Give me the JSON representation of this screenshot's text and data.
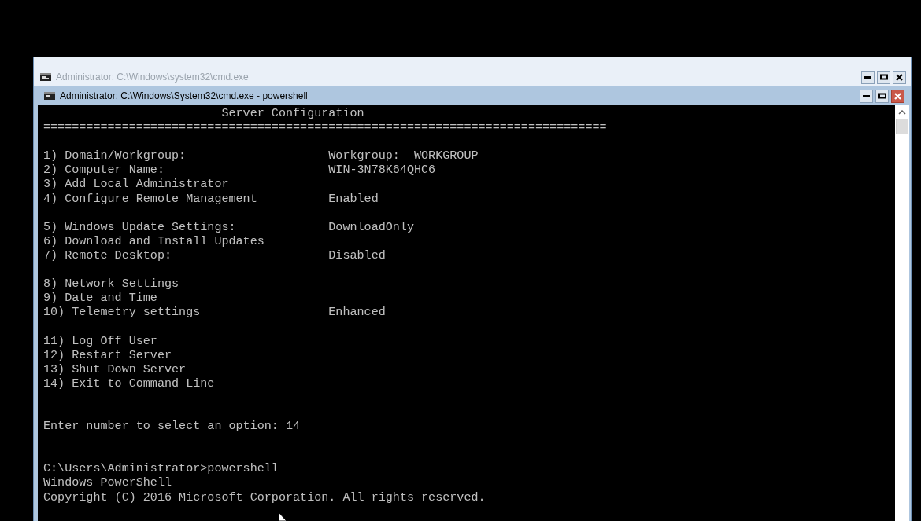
{
  "windows": [
    {
      "title": "Administrator: C:\\Windows\\system32\\cmd.exe",
      "active": false
    },
    {
      "title": "Administrator: C:\\Windows\\System32\\cmd.exe - powershell",
      "active": true,
      "console": {
        "heading": "Server Configuration",
        "rule": "===============================================================================",
        "menu_groups": [
          [
            {
              "label": "1) Domain/Workgroup:",
              "value": "Workgroup:  WORKGROUP"
            },
            {
              "label": "2) Computer Name:",
              "value": "WIN-3N78K64QHC6"
            },
            {
              "label": "3) Add Local Administrator"
            },
            {
              "label": "4) Configure Remote Management",
              "value": "Enabled"
            }
          ],
          [
            {
              "label": "5) Windows Update Settings:",
              "value": "DownloadOnly"
            },
            {
              "label": "6) Download and Install Updates"
            },
            {
              "label": "7) Remote Desktop:",
              "value": "Disabled"
            }
          ],
          [
            {
              "label": "8) Network Settings"
            },
            {
              "label": "9) Date and Time"
            },
            {
              "label": "10) Telemetry settings",
              "value": "Enhanced"
            }
          ],
          [
            {
              "label": "11) Log Off User"
            },
            {
              "label": "12) Restart Server"
            },
            {
              "label": "13) Shut Down Server"
            },
            {
              "label": "14) Exit to Command Line"
            }
          ]
        ],
        "prompt": "Enter number to select an option: 14",
        "output": [
          "C:\\Users\\Administrator>powershell",
          "Windows PowerShell",
          "Copyright (C) 2016 Microsoft Corporation. All rights reserved."
        ]
      }
    }
  ]
}
